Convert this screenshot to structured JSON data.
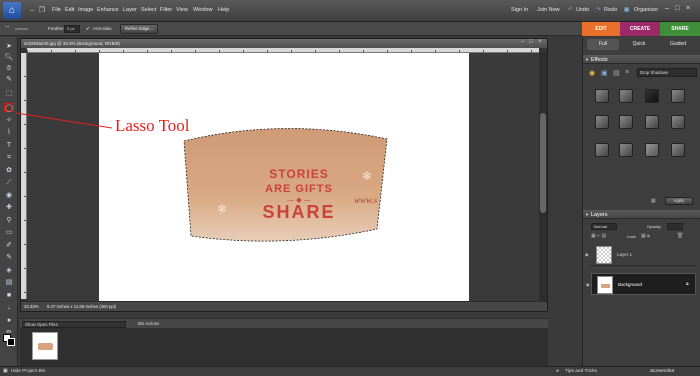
{
  "menubar": {
    "items": [
      "File",
      "Edit",
      "Image",
      "Enhance",
      "Layer",
      "Select",
      "Filter",
      "View",
      "Window",
      "Help"
    ],
    "sign_in": "Sign In",
    "join_now": "Join Now",
    "undo": "Undo",
    "redo": "Redo",
    "organizer": "Organizer"
  },
  "options": {
    "feather_label": "Feather:",
    "feather_value": "0 px",
    "antialias_label": "Anti-alias",
    "refine_edge_label": "Refine Edge..."
  },
  "modes": {
    "edit": "EDIT",
    "create": "CREATE",
    "share": "SHARE",
    "sub_tabs": [
      "Full",
      "Quick",
      "Guided"
    ]
  },
  "document": {
    "title": "sc0283a240.jpg @ 33.3% (Background, RGB/8)",
    "zoom": "33.33%",
    "doc_info": "8.47 Inches x 11.69 Inches (300 ppi)"
  },
  "artwork": {
    "line1": "STORIES",
    "line2": "ARE GIFTS",
    "line3": "SHARE",
    "partial": "www.s"
  },
  "annotation": {
    "label": "Lasso Tool"
  },
  "bin": {
    "dropdown": "Show Open Files",
    "actions": "Bin Actions"
  },
  "footer": {
    "hide_bin": "Hide Project Bin",
    "tips": "Tips and Tricks",
    "watermark": "Screenshot"
  },
  "effects": {
    "title": "Effects",
    "dropdown": "Drop Shadows",
    "apply": "Apply"
  },
  "layers": {
    "title": "Layers",
    "blend_mode": "Normal",
    "opacity_label": "Opacity:",
    "lock_label": "Lock:",
    "items": [
      "Layer 1",
      "Background"
    ]
  },
  "colors": {
    "edit_tab": "#e8702a",
    "create_tab": "#9c2a6a",
    "share_tab": "#3f8e3a",
    "annotation": "#e5201d",
    "sleeve": "#d6a37e",
    "artwork_text": "#c9423b"
  }
}
